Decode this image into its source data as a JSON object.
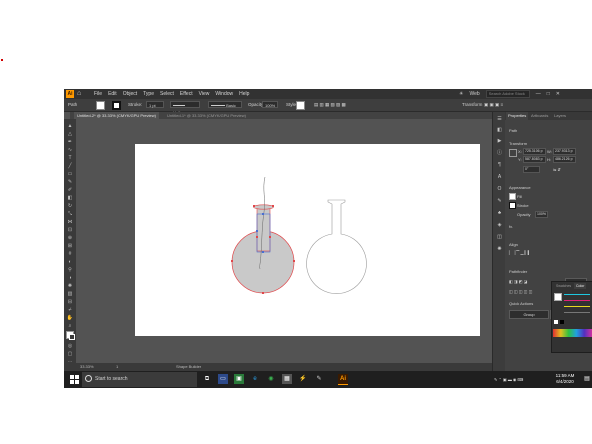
{
  "menubar": {
    "logo": "Ai",
    "items": [
      "File",
      "Edit",
      "Object",
      "Type",
      "Select",
      "Effect",
      "View",
      "Window",
      "Help"
    ],
    "workspace": "Web",
    "search_placeholder": "Search Adobe Stock"
  },
  "controlbar": {
    "selection": "Path",
    "stroke_label": "Stroke:",
    "stroke_weight": "1 pt",
    "profile": "Uniform",
    "brush": "Basic",
    "opacity_label": "Opacity:",
    "opacity": "100%",
    "style_label": "Style:",
    "transform": "Transform"
  },
  "tabs": [
    {
      "label": "Untitled-2* @ 33.33% (CMYK/GPU Preview)"
    },
    {
      "label": "Untitled-1* @ 33.33% (CMYK/GPU Preview)"
    }
  ],
  "statusbar": {
    "zoom": "33.33%",
    "page": "1",
    "tool": "Shape Builder"
  },
  "properties": {
    "tabs": [
      "Properties",
      "Artboards",
      "Layers"
    ],
    "selection": "Path",
    "transform_title": "Transform",
    "x_label": "X:",
    "x_value": "725.3106 p",
    "y_label": "Y:",
    "y_value": "587.8083 p",
    "w_label": "W:",
    "w_value": "237.9313 p",
    "h_label": "H:",
    "h_value": "486.2126 p",
    "angle": "0°",
    "appearance_title": "Appearance",
    "fill_label": "Fill",
    "stroke_label": "Stroke",
    "opacity_label": "Opacity",
    "opacity_value": "100%",
    "fx": "fx.",
    "align_title": "Align",
    "pathfinder_title": "Pathfinder",
    "shape_modes_expand": "Expand",
    "quick_actions_title": "Quick Actions",
    "group_btn": "Group",
    "recolor_btn": "Recolor"
  },
  "color_panel": {
    "tabs": [
      "Swatches",
      "Color"
    ]
  },
  "taskbar": {
    "search_placeholder": "Start to search",
    "time": "11:59 AM",
    "date": "6/4/2020",
    "ai_label": "Ai"
  },
  "colors": {
    "app_bg": "#535353",
    "chrome": "#323232",
    "shape_fill": "#c9c9c9",
    "selection_red": "#e0474a",
    "selection_blue": "#4a6fd1"
  }
}
